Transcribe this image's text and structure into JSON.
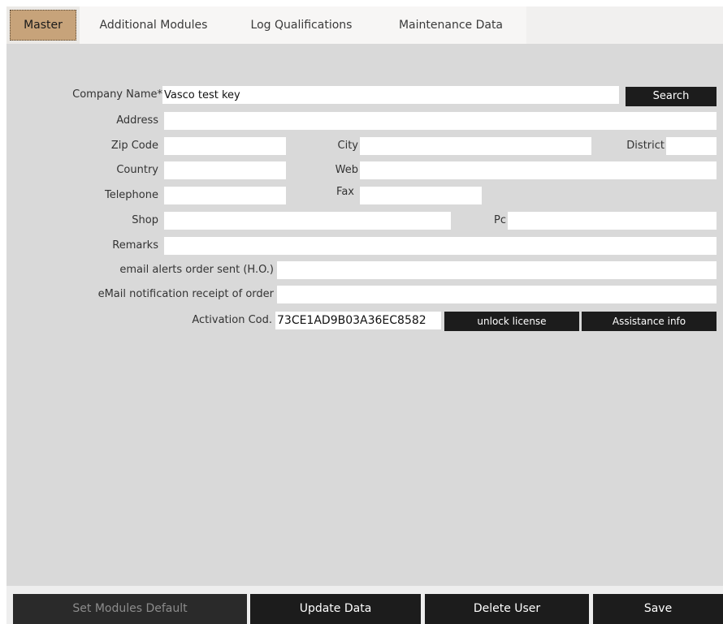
{
  "tabs": [
    {
      "label": "Master",
      "active": true
    },
    {
      "label": "Additional Modules",
      "active": false
    },
    {
      "label": "Log Qualifications",
      "active": false
    },
    {
      "label": "Maintenance Data",
      "active": false
    }
  ],
  "form": {
    "company_name": {
      "label": "Company Name*",
      "value": "Vasco test key"
    },
    "search_button": "Search",
    "address": {
      "label": "Address",
      "value": ""
    },
    "zip_code": {
      "label": "Zip Code",
      "value": ""
    },
    "city": {
      "label": "City",
      "value": ""
    },
    "district": {
      "label": "District",
      "value": ""
    },
    "country": {
      "label": "Country",
      "value": ""
    },
    "web": {
      "label": "Web",
      "value": ""
    },
    "telephone": {
      "label": "Telephone",
      "value": ""
    },
    "fax": {
      "label": "Fax",
      "value": ""
    },
    "shop": {
      "label": "Shop",
      "value": ""
    },
    "pc": {
      "label": "Pc",
      "value": ""
    },
    "remarks": {
      "label": "Remarks",
      "value": ""
    },
    "email_alerts": {
      "label": "email alerts order sent (H.O.)",
      "value": ""
    },
    "email_notification": {
      "label": "eMail notification receipt of order",
      "value": ""
    },
    "activation_code": {
      "label": "Activation Cod.",
      "value": "73CE1AD9B03A36EC8582"
    },
    "unlock_license_button": "unlock license",
    "assistance_info_button": "Assistance info"
  },
  "bottom_buttons": {
    "set_modules_default": {
      "label": "Set Modules Default",
      "disabled": true
    },
    "update_data": {
      "label": "Update Data"
    },
    "delete_user": {
      "label": "Delete User"
    },
    "save": {
      "label": "Save"
    }
  },
  "colors": {
    "active_tab": "#c7a37a",
    "panel_bg": "#d9d9d9",
    "button_bg": "#1c1c1c"
  }
}
